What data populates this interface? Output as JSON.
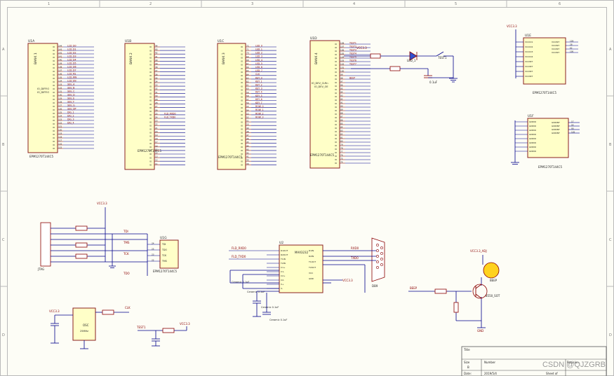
{
  "border": {
    "cols": [
      "1",
      "2",
      "3",
      "4",
      "5",
      "6"
    ],
    "rows": [
      "A",
      "B",
      "C",
      "D"
    ]
  },
  "chips": {
    "u1a": {
      "ref": "U1A",
      "bank": "BANK 1",
      "part": "EPM1270T144C5",
      "pins_left": [
        "IO_DIFFIO",
        "IO_DIFFIO"
      ],
      "nets": [
        "LCD_D0",
        "LCD_D1",
        "LCD_D2",
        "LCD_D3",
        "LCD_D4",
        "LCD_D5",
        "LCD_D6",
        "LCD_D7",
        "LCD_RS",
        "LCD_RW",
        "LCD_EN",
        "SEG_A",
        "SEG_B",
        "SEG_C",
        "SEG_D",
        "SEG_E",
        "SEG_F",
        "SEG_G",
        "SEG_DP",
        "DIG_1",
        "DIG_2",
        "DIG_3",
        "DIG_4"
      ]
    },
    "u1b": {
      "ref": "U1B",
      "bank": "BANK 2",
      "part": "EPM1270T144C5",
      "nets": [
        "FLD_RXD0",
        "FLD_TXD0"
      ]
    },
    "u1c": {
      "ref": "U1C",
      "bank": "BANK 3",
      "part": "EPM1270T144C5",
      "nets": [
        "LED_0",
        "LED_1",
        "LED_2",
        "LED_3",
        "LED_4",
        "LED_5",
        "LED_6",
        "LED_7",
        "CLK",
        "KEY_0",
        "KEY_1",
        "KEY_2",
        "KEY_3",
        "KEY_4",
        "KEY_5",
        "KEY_6",
        "KEY_7",
        "ROW_0",
        "ROW_1",
        "ROW_2",
        "ROW_3"
      ]
    },
    "u1d": {
      "ref": "U1D",
      "bank": "BANK 4",
      "part": "EPM1270T144C5",
      "nets": [
        "TEST1",
        "TEST2",
        "TEST3",
        "TEST4",
        "TEST5",
        "TEST6",
        "TEST7",
        "BEEP"
      ],
      "pins_left": [
        "IO_DEV_CLRn",
        "IO_DEV_OE"
      ]
    },
    "u1e": {
      "ref": "U1E",
      "part": "EPM1270T144C5",
      "pins_left": [
        "VCCIO1",
        "VCCIO2",
        "VCCIO3",
        "VCCIO4",
        "VCCINT",
        "VCCINT",
        "VCCINT",
        "VCCINT"
      ],
      "pins_right": [
        "VCCINT",
        "VCCINT",
        "VCCINT",
        "VCCINT"
      ],
      "pin_nums": [
        "128",
        "28",
        "62",
        "100"
      ]
    },
    "u1f": {
      "ref": "U1F",
      "part": "EPM1270T144C5",
      "pins_left": [
        "GNDIO",
        "GNDIO",
        "GNDIO",
        "GNDIO",
        "GNDIO",
        "GNDIO",
        "GNDIO",
        "GNDIO"
      ],
      "pins_right": [
        "GNDINT",
        "GNDINT",
        "GNDINT",
        "GNDINT"
      ],
      "pin_nums": [
        "17",
        "54",
        "90",
        "126"
      ]
    },
    "u1g": {
      "ref": "U1G",
      "part": "EPM1270T144C5",
      "pins": [
        "TDI",
        "TDO",
        "TCK",
        "TMS"
      ],
      "pin_nums": [
        "24",
        "25",
        "23",
        "22"
      ]
    },
    "u2": {
      "ref": "U2",
      "name": "MAX3232",
      "pins_left": [
        "R1OUT",
        "R2OUT",
        "T1IN",
        "T2IN",
        "C1+",
        "C1-",
        "C2+",
        "C2-",
        "V+",
        "V-"
      ],
      "pins_right": [
        "R1IN",
        "R2IN",
        "T1OUT",
        "T2OUT",
        "VCC",
        "GND"
      ],
      "nets": [
        "FLD_RXD0",
        "FLD_TXD0"
      ],
      "rs_nets": [
        "RXD0",
        "TXD0"
      ],
      "caps": [
        "Ceramic 0.1uF",
        "Ceramic 0.1uF",
        "Ceramic 0.1uF",
        "Ceramic 0.1uF"
      ]
    },
    "osc": {
      "ref": "OSC1",
      "name": "OSC",
      "freq": "25MHz"
    }
  },
  "labels": {
    "vcc": "VCC3.3",
    "vcc_adj": "VCC3.3_ADJ",
    "gnd": "GND",
    "led": "LED_1",
    "test": "TEST1",
    "beep": "BEEP",
    "transistor": "8550_SOT",
    "jtag_conn": "JTAG",
    "jtag_nets": [
      "TDI",
      "TMS",
      "TCK",
      "TDO"
    ],
    "db9": "DB9",
    "res": [
      "R1",
      "R2",
      "R3",
      "R4",
      "R5",
      "R11",
      "R12",
      "R13",
      "R15"
    ],
    "res_vals": [
      "10K",
      "10K",
      "4.7K",
      "100K",
      "33",
      "100R"
    ],
    "caps": [
      "C1",
      "C2",
      "C11",
      "C22"
    ],
    "cap_vals": [
      "0.1uF",
      "0.1uF",
      "0.1uF"
    ],
    "clk_net": "CLK"
  },
  "titleblock": {
    "title_label": "Title",
    "size_label": "Size",
    "number_label": "Number",
    "revision_label": "Revision",
    "size_value": "B",
    "date_label": "Date:",
    "date_value": "2019/5/4",
    "sheet_label": "Sheet of"
  },
  "watermark": "CSDN @QJZGRB"
}
